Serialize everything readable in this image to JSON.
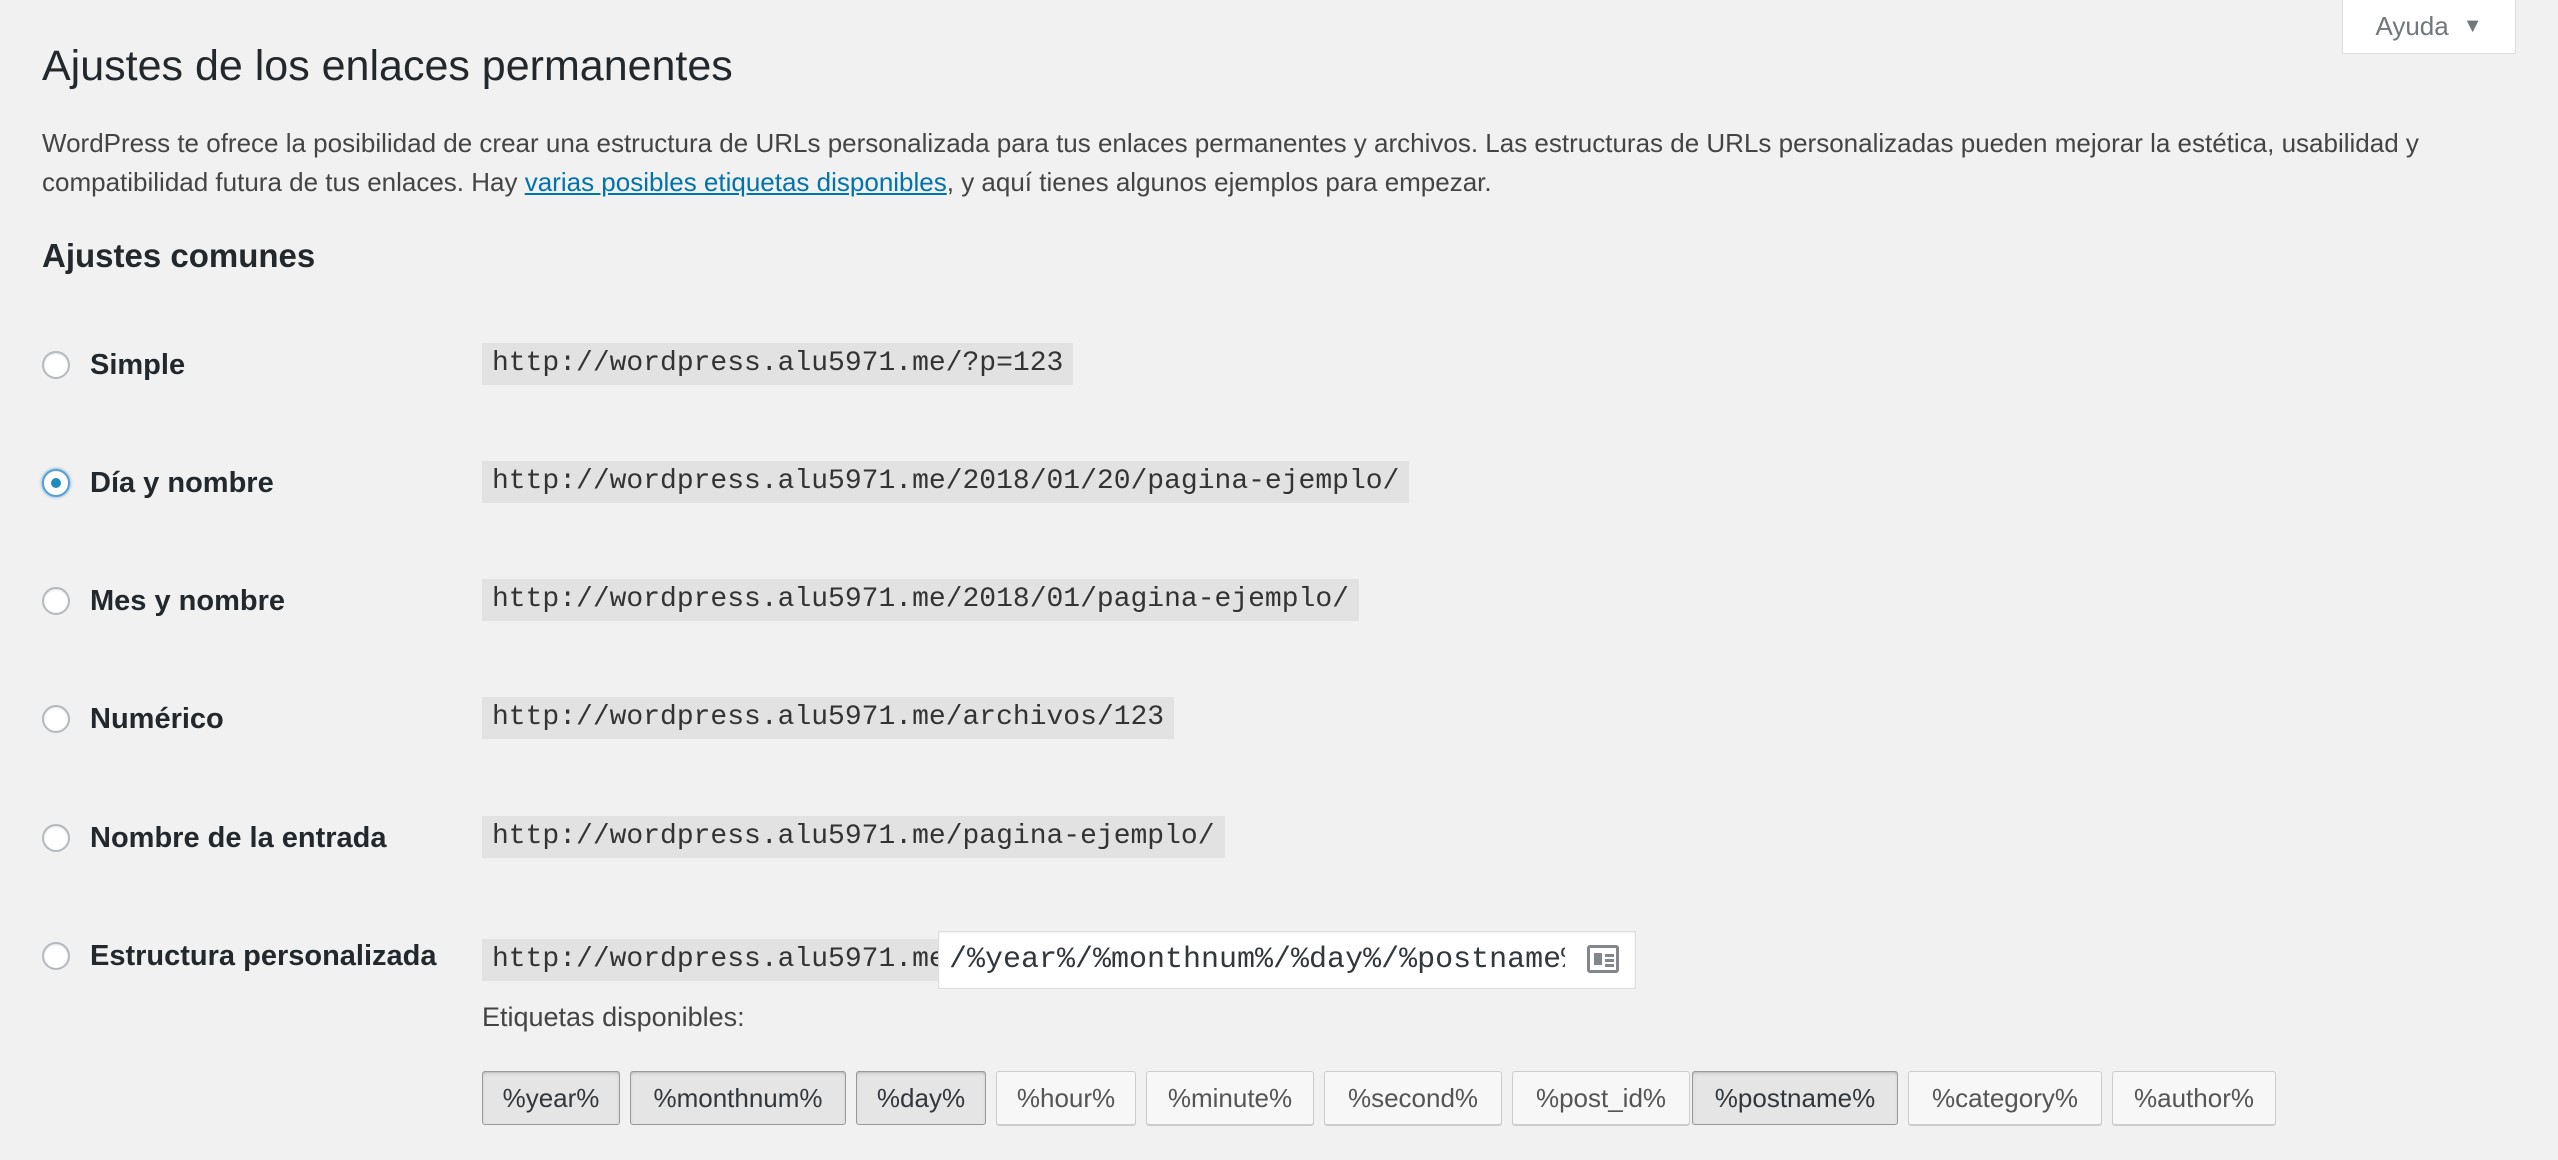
{
  "help": {
    "label": "Ayuda",
    "arrow": "▼"
  },
  "page_title": "Ajustes de los enlaces permanentes",
  "intro": {
    "before": "WordPress te ofrece la posibilidad de crear una estructura de URLs personalizada para tus enlaces permanentes y archivos. Las estructuras de URLs personalizadas pueden mejorar la estética, usabilidad y compatibilidad futura de tus enlaces. Hay ",
    "link": "varias posibles etiquetas disponibles",
    "after": ", y aquí tienes algunos ejemplos para empezar."
  },
  "section_title": "Ajustes comunes",
  "options": [
    {
      "label": "Simple",
      "example": "http://wordpress.alu5971.me/?p=123",
      "checked": false
    },
    {
      "label": "Día y nombre",
      "example": "http://wordpress.alu5971.me/2018/01/20/pagina-ejemplo/",
      "checked": true
    },
    {
      "label": "Mes y nombre",
      "example": "http://wordpress.alu5971.me/2018/01/pagina-ejemplo/",
      "checked": false
    },
    {
      "label": "Numérico",
      "example": "http://wordpress.alu5971.me/archivos/123",
      "checked": false
    },
    {
      "label": "Nombre de la entrada",
      "example": "http://wordpress.alu5971.me/pagina-ejemplo/",
      "checked": false
    },
    {
      "label": "Estructura personalizada",
      "example": "http://wordpress.alu5971.me",
      "checked": false
    }
  ],
  "custom": {
    "value": "/%year%/%monthnum%/%day%/%postname%/"
  },
  "tags_label": "Etiquetas disponibles:",
  "tags": [
    {
      "label": "%year%",
      "active": true
    },
    {
      "label": "%monthnum%",
      "active": true
    },
    {
      "label": "%day%",
      "active": true
    },
    {
      "label": "%hour%",
      "active": false
    },
    {
      "label": "%minute%",
      "active": false
    },
    {
      "label": "%second%",
      "active": false
    },
    {
      "label": "%post_id%",
      "active": false
    },
    {
      "label": "%postname%",
      "active": true
    },
    {
      "label": "%category%",
      "active": false
    },
    {
      "label": "%author%",
      "active": false
    }
  ]
}
